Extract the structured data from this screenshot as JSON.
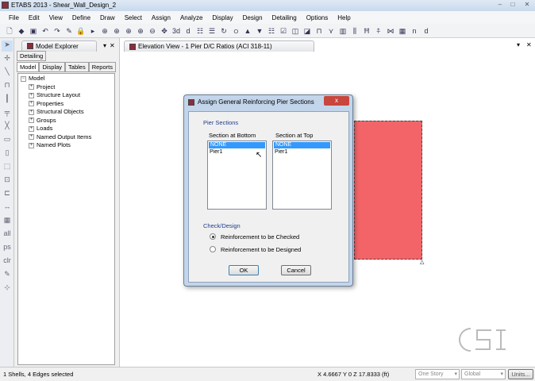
{
  "window": {
    "title": "ETABS 2013  - Shear_Wall_Design_2"
  },
  "menu": [
    "File",
    "Edit",
    "View",
    "Define",
    "Draw",
    "Select",
    "Assign",
    "Analyze",
    "Display",
    "Design",
    "Detailing",
    "Options",
    "Help"
  ],
  "toolbar": [
    "new-icon",
    "open-icon",
    "save-icon",
    "undo-icon",
    "redo-icon",
    "pencil-icon",
    "lock-icon",
    "run-icon",
    "zoom-window-icon",
    "zoom-in-icon",
    "zoom-out-icon",
    "zoom-extent-icon",
    "zoom-prev-icon",
    "pan-icon",
    "3d-view-icon",
    "plan-view-icon",
    "elev-view-icon",
    "rotate-icon",
    "perspective-icon",
    "move-up-icon",
    "move-down-icon",
    "object-shrink-icon",
    "checkbox-icon",
    "display-options-icon",
    "shade-icon",
    "frame-icon",
    "brace-icon",
    "wall-icon",
    "floor-icon",
    "beam-icon",
    "point-icon",
    "section-icon",
    "grid-icon",
    "nd-icon",
    "text-cursor-icon",
    "select-box-icon"
  ],
  "explorer": {
    "title": "Model Explorer",
    "tab_top": "Detailing",
    "tabs": [
      "Model",
      "Display",
      "Tables",
      "Reports"
    ],
    "tree_root": "Model",
    "tree": [
      "Project",
      "Structure Layout",
      "Properties",
      "Structural Objects",
      "Groups",
      "Loads",
      "Named Output Items",
      "Named Plots"
    ]
  },
  "view": {
    "title": "Elevation View - 1  Pier D/C Ratios  (ACI 318-11)"
  },
  "dialog": {
    "title": "Assign General Reinforcing Pier Sections",
    "group1": "Pier Sections",
    "bottom_label": "Section at Bottom",
    "top_label": "Section at Top",
    "bottom_items": [
      "NONE",
      "Pier1"
    ],
    "top_items": [
      "NONE",
      "Pier1"
    ],
    "group2": "Check/Design",
    "radio1": "Reinforcement to be Checked",
    "radio2": "Reinforcement to be Designed",
    "ok": "OK",
    "cancel": "Cancel",
    "close": "x"
  },
  "status": {
    "selection": "1 Shells, 4 Edges selected",
    "coords": "X 4.6667  Y 0  Z 17.8333 (ft)",
    "story": "One Story",
    "coord_sys": "Global",
    "units": "Units..."
  },
  "colors": {
    "wall": "#f36468",
    "selection": "#3399ff"
  }
}
